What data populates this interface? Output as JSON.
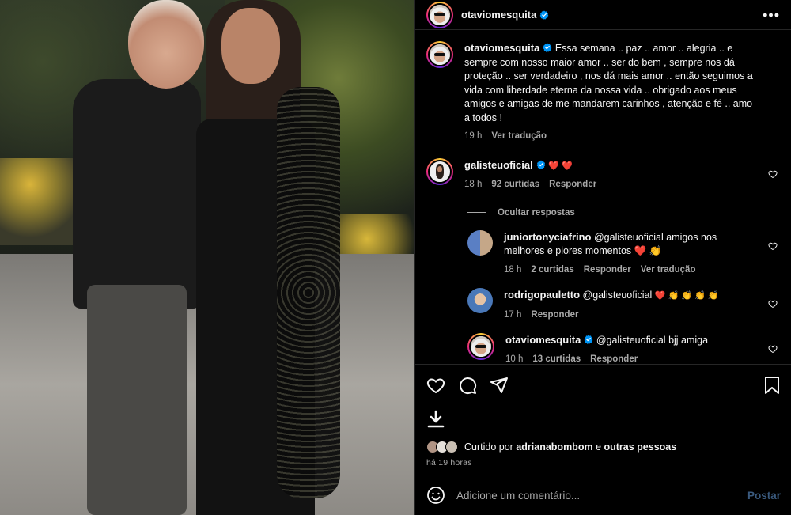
{
  "post": {
    "author": "otaviomesquita"
  },
  "caption": {
    "username": "otaviomesquita",
    "text": "Essa semana .. paz .. amor .. alegria .. e sempre com nosso maior amor .. ser do bem , sempre nos dá proteção .. ser verdadeiro , nos dá mais amor .. então seguimos a vida com liberdade eterna da nossa vida .. obrigado aos meus amigos e amigas de me mandarem carinhos , atenção e fé .. amo a todos !",
    "time": "19 h",
    "translate": "Ver tradução"
  },
  "comment": {
    "username": "galisteuoficial",
    "text": "❤️ ❤️",
    "time": "18 h",
    "likes": "92 curtidas",
    "reply": "Responder",
    "hide_replies": "Ocultar respostas"
  },
  "replies": [
    {
      "username": "juniortonyciafrino",
      "mention": "@galisteuoficial",
      "text": "amigos nos melhores e piores momentos ❤️ 👏",
      "time": "18 h",
      "likes": "2 curtidas",
      "reply": "Responder",
      "translate": "Ver tradução"
    },
    {
      "username": "rodrigopauletto",
      "mention": "@galisteuoficial",
      "text": "❤️ 👏 👏 👏 👏",
      "time": "17 h",
      "reply": "Responder"
    },
    {
      "username": "otaviomesquita",
      "mention": "@galisteuoficial",
      "text": "bjj amiga",
      "time": "10 h",
      "likes": "13 curtidas",
      "reply": "Responder"
    }
  ],
  "likes": {
    "prefix": "Curtido por",
    "user": "adrianabombom",
    "joiner": "e",
    "others": "outras pessoas",
    "ago": "há 19 horas"
  },
  "add_comment": {
    "placeholder": "Adicione um comentário...",
    "post": "Postar"
  },
  "icons": {
    "more": "more-options-icon",
    "like": "heart-icon",
    "comment": "comment-icon",
    "share": "share-icon",
    "save": "bookmark-icon",
    "download": "download-icon",
    "emoji": "emoji-icon"
  },
  "colors": {
    "background": "#000000",
    "text": "#f5f5f5",
    "secondary": "#a8a8a8",
    "verified": "#0095f6",
    "heart": "#ed4956",
    "post_button_disabled": "#3a5a7e"
  }
}
